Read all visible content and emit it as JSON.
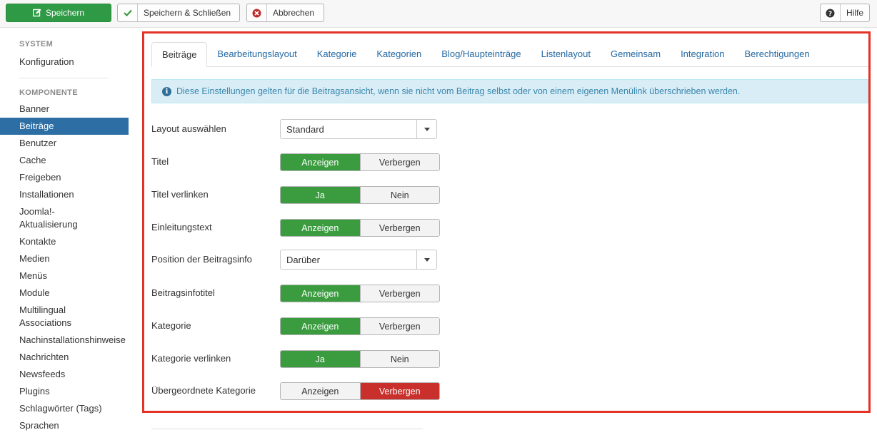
{
  "toolbar": {
    "save_label": "Speichern",
    "save_close_label": "Speichern & Schließen",
    "cancel_label": "Abbrechen",
    "help_label": "Hilfe"
  },
  "sidebar": {
    "section_system": "SYSTEM",
    "system_items": [
      "Konfiguration"
    ],
    "section_components": "KOMPONENTE",
    "items": [
      "Banner",
      "Beiträge",
      "Benutzer",
      "Cache",
      "Freigeben",
      "Installationen",
      "Joomla!-Aktualisierung",
      "Kontakte",
      "Medien",
      "Menüs",
      "Module",
      "Multilingual Associations",
      "Nachinstallationshinweise",
      "Nachrichten",
      "Newsfeeds",
      "Plugins",
      "Schlagwörter (Tags)",
      "Sprachen"
    ],
    "active_item": "Beiträge"
  },
  "tabs": [
    "Beiträge",
    "Bearbeitungslayout",
    "Kategorie",
    "Kategorien",
    "Blog/Haupteinträge",
    "Listenlayout",
    "Gemeinsam",
    "Integration",
    "Berechtigungen"
  ],
  "active_tab": "Beiträge",
  "info_text": "Diese Einstellungen gelten für die Beitragsansicht, wenn sie nicht vom Beitrag selbst oder von einem eigenen Menülink überschrieben werden.",
  "fields": {
    "layout": {
      "label": "Layout auswählen",
      "value": "Standard"
    },
    "title": {
      "label": "Titel",
      "opt1": "Anzeigen",
      "opt2": "Verbergen"
    },
    "title_link": {
      "label": "Titel verlinken",
      "opt1": "Ja",
      "opt2": "Nein"
    },
    "intro": {
      "label": "Einleitungstext",
      "opt1": "Anzeigen",
      "opt2": "Verbergen"
    },
    "info_position": {
      "label": "Position der Beitragsinfo",
      "value": "Darüber"
    },
    "info_title": {
      "label": "Beitragsinfotitel",
      "opt1": "Anzeigen",
      "opt2": "Verbergen"
    },
    "category": {
      "label": "Kategorie",
      "opt1": "Anzeigen",
      "opt2": "Verbergen"
    },
    "category_link": {
      "label": "Kategorie verlinken",
      "opt1": "Ja",
      "opt2": "Nein"
    },
    "parent_category": {
      "label": "Übergeordnete Kategorie",
      "opt1": "Anzeigen",
      "opt2": "Verbergen"
    }
  },
  "colors": {
    "accent_green": "#3a9c3f",
    "accent_red": "#c9302c",
    "highlight_border": "#e53227"
  }
}
